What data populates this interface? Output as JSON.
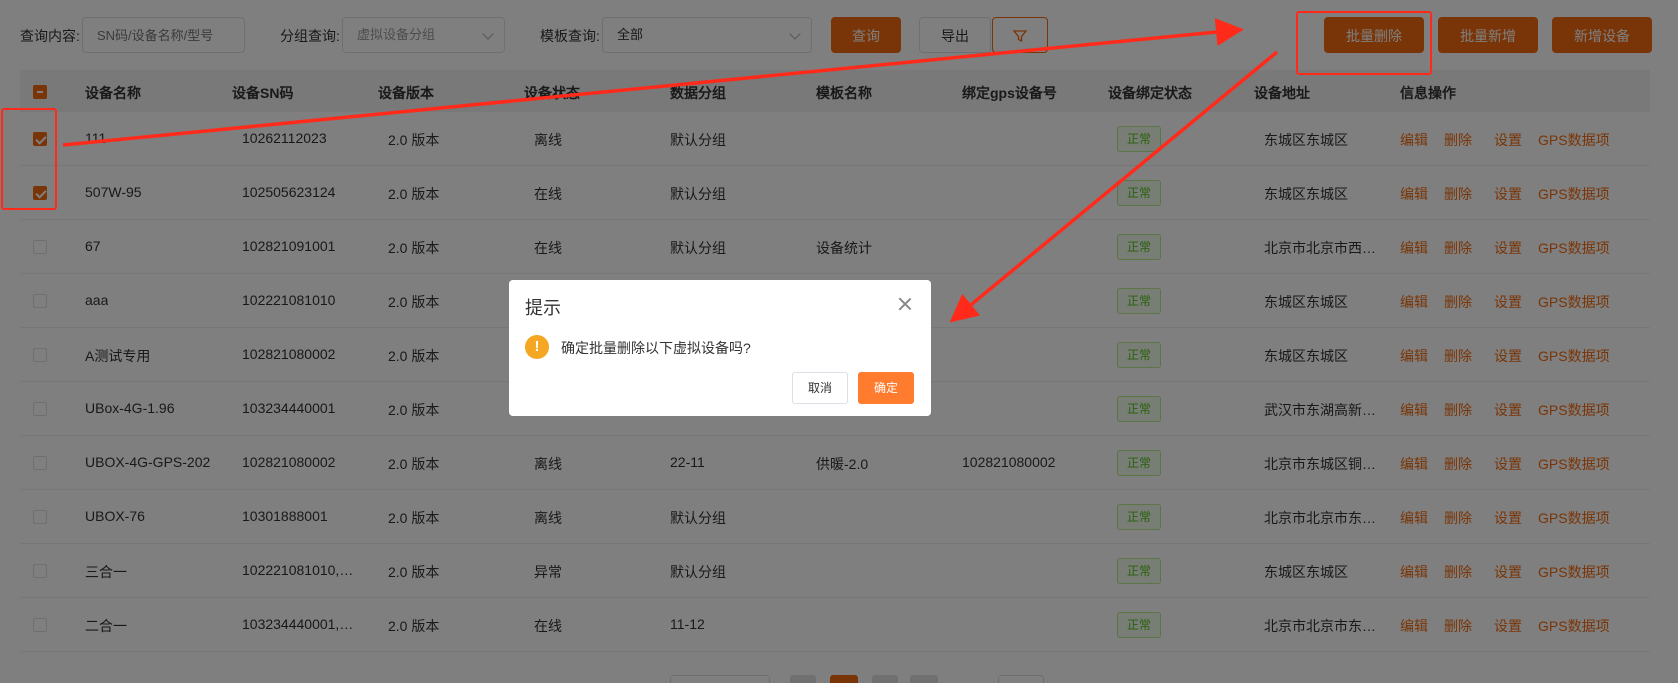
{
  "filters": {
    "query_label": "查询内容:",
    "query_placeholder": "SN码/设备名称/型号",
    "group_label": "分组查询:",
    "group_value": "虚拟设备分组",
    "template_label": "模板查询:",
    "template_value": "全部"
  },
  "actions": {
    "search": "查询",
    "export": "导出",
    "batch_delete": "批量删除",
    "batch_add": "批量新增",
    "add_device": "新增设备"
  },
  "table": {
    "headers": [
      "设备名称",
      "设备SN码",
      "设备版本",
      "设备状态",
      "数据分组",
      "模板名称",
      "绑定gps设备号",
      "设备绑定状态",
      "设备地址",
      "信息操作"
    ],
    "ops": [
      "编辑",
      "删除",
      "设置",
      "GPS数据项"
    ],
    "rows": [
      {
        "name": "111",
        "sn": "10262112023",
        "version": "2.0 版本",
        "status": "离线",
        "group": "默认分组",
        "template": "",
        "gps": "",
        "bind": "正常",
        "address": "东城区东城区",
        "checked": true
      },
      {
        "name": "507W-95",
        "sn": "102505623124",
        "version": "2.0 版本",
        "status": "在线",
        "group": "默认分组",
        "template": "",
        "gps": "",
        "bind": "正常",
        "address": "东城区东城区",
        "checked": true
      },
      {
        "name": "67",
        "sn": "102821091001",
        "version": "2.0 版本",
        "status": "在线",
        "group": "默认分组",
        "template": "设备统计",
        "gps": "",
        "bind": "正常",
        "address": "北京市北京市西…",
        "checked": false
      },
      {
        "name": "aaa",
        "sn": "102221081010",
        "version": "2.0 版本",
        "status": "",
        "group": "",
        "template": "",
        "gps": "",
        "bind": "正常",
        "address": "东城区东城区",
        "checked": false
      },
      {
        "name": "A测试专用",
        "sn": "102821080002",
        "version": "2.0 版本",
        "status": "",
        "group": "",
        "template": "",
        "gps": "",
        "bind": "正常",
        "address": "东城区东城区",
        "checked": false
      },
      {
        "name": "UBox-4G-1.96",
        "sn": "103234440001",
        "version": "2.0 版本",
        "status": "",
        "group": "",
        "template": "",
        "gps": "",
        "bind": "正常",
        "address": "武汉市东湖高新…",
        "checked": false
      },
      {
        "name": "UBOX-4G-GPS-202",
        "sn": "102821080002",
        "version": "2.0 版本",
        "status": "离线",
        "group": "22-11",
        "template": "供暖-2.0",
        "gps": "102821080002",
        "bind": "正常",
        "address": "北京市东城区铜…",
        "checked": false
      },
      {
        "name": "UBOX-76",
        "sn": "10301888001",
        "version": "2.0 版本",
        "status": "离线",
        "group": "默认分组",
        "template": "",
        "gps": "",
        "bind": "正常",
        "address": "北京市北京市东…",
        "checked": false
      },
      {
        "name": "三合一",
        "sn": "102221081010,…",
        "version": "2.0 版本",
        "status": "异常",
        "group": "默认分组",
        "template": "",
        "gps": "",
        "bind": "正常",
        "address": "东城区东城区",
        "checked": false
      },
      {
        "name": "二合一",
        "sn": "103234440001,…",
        "version": "2.0 版本",
        "status": "在线",
        "group": "11-12",
        "template": "",
        "gps": "",
        "bind": "正常",
        "address": "北京市北京市东…",
        "checked": false
      }
    ]
  },
  "dialog": {
    "title": "提示",
    "message": "确定批量删除以下虚拟设备吗?",
    "cancel": "取消",
    "confirm": "确定"
  },
  "colors": {
    "accent": "#f26b10",
    "annotation": "#ff2a1a",
    "tag_green": "#52c41a",
    "warning": "#f5a623"
  }
}
